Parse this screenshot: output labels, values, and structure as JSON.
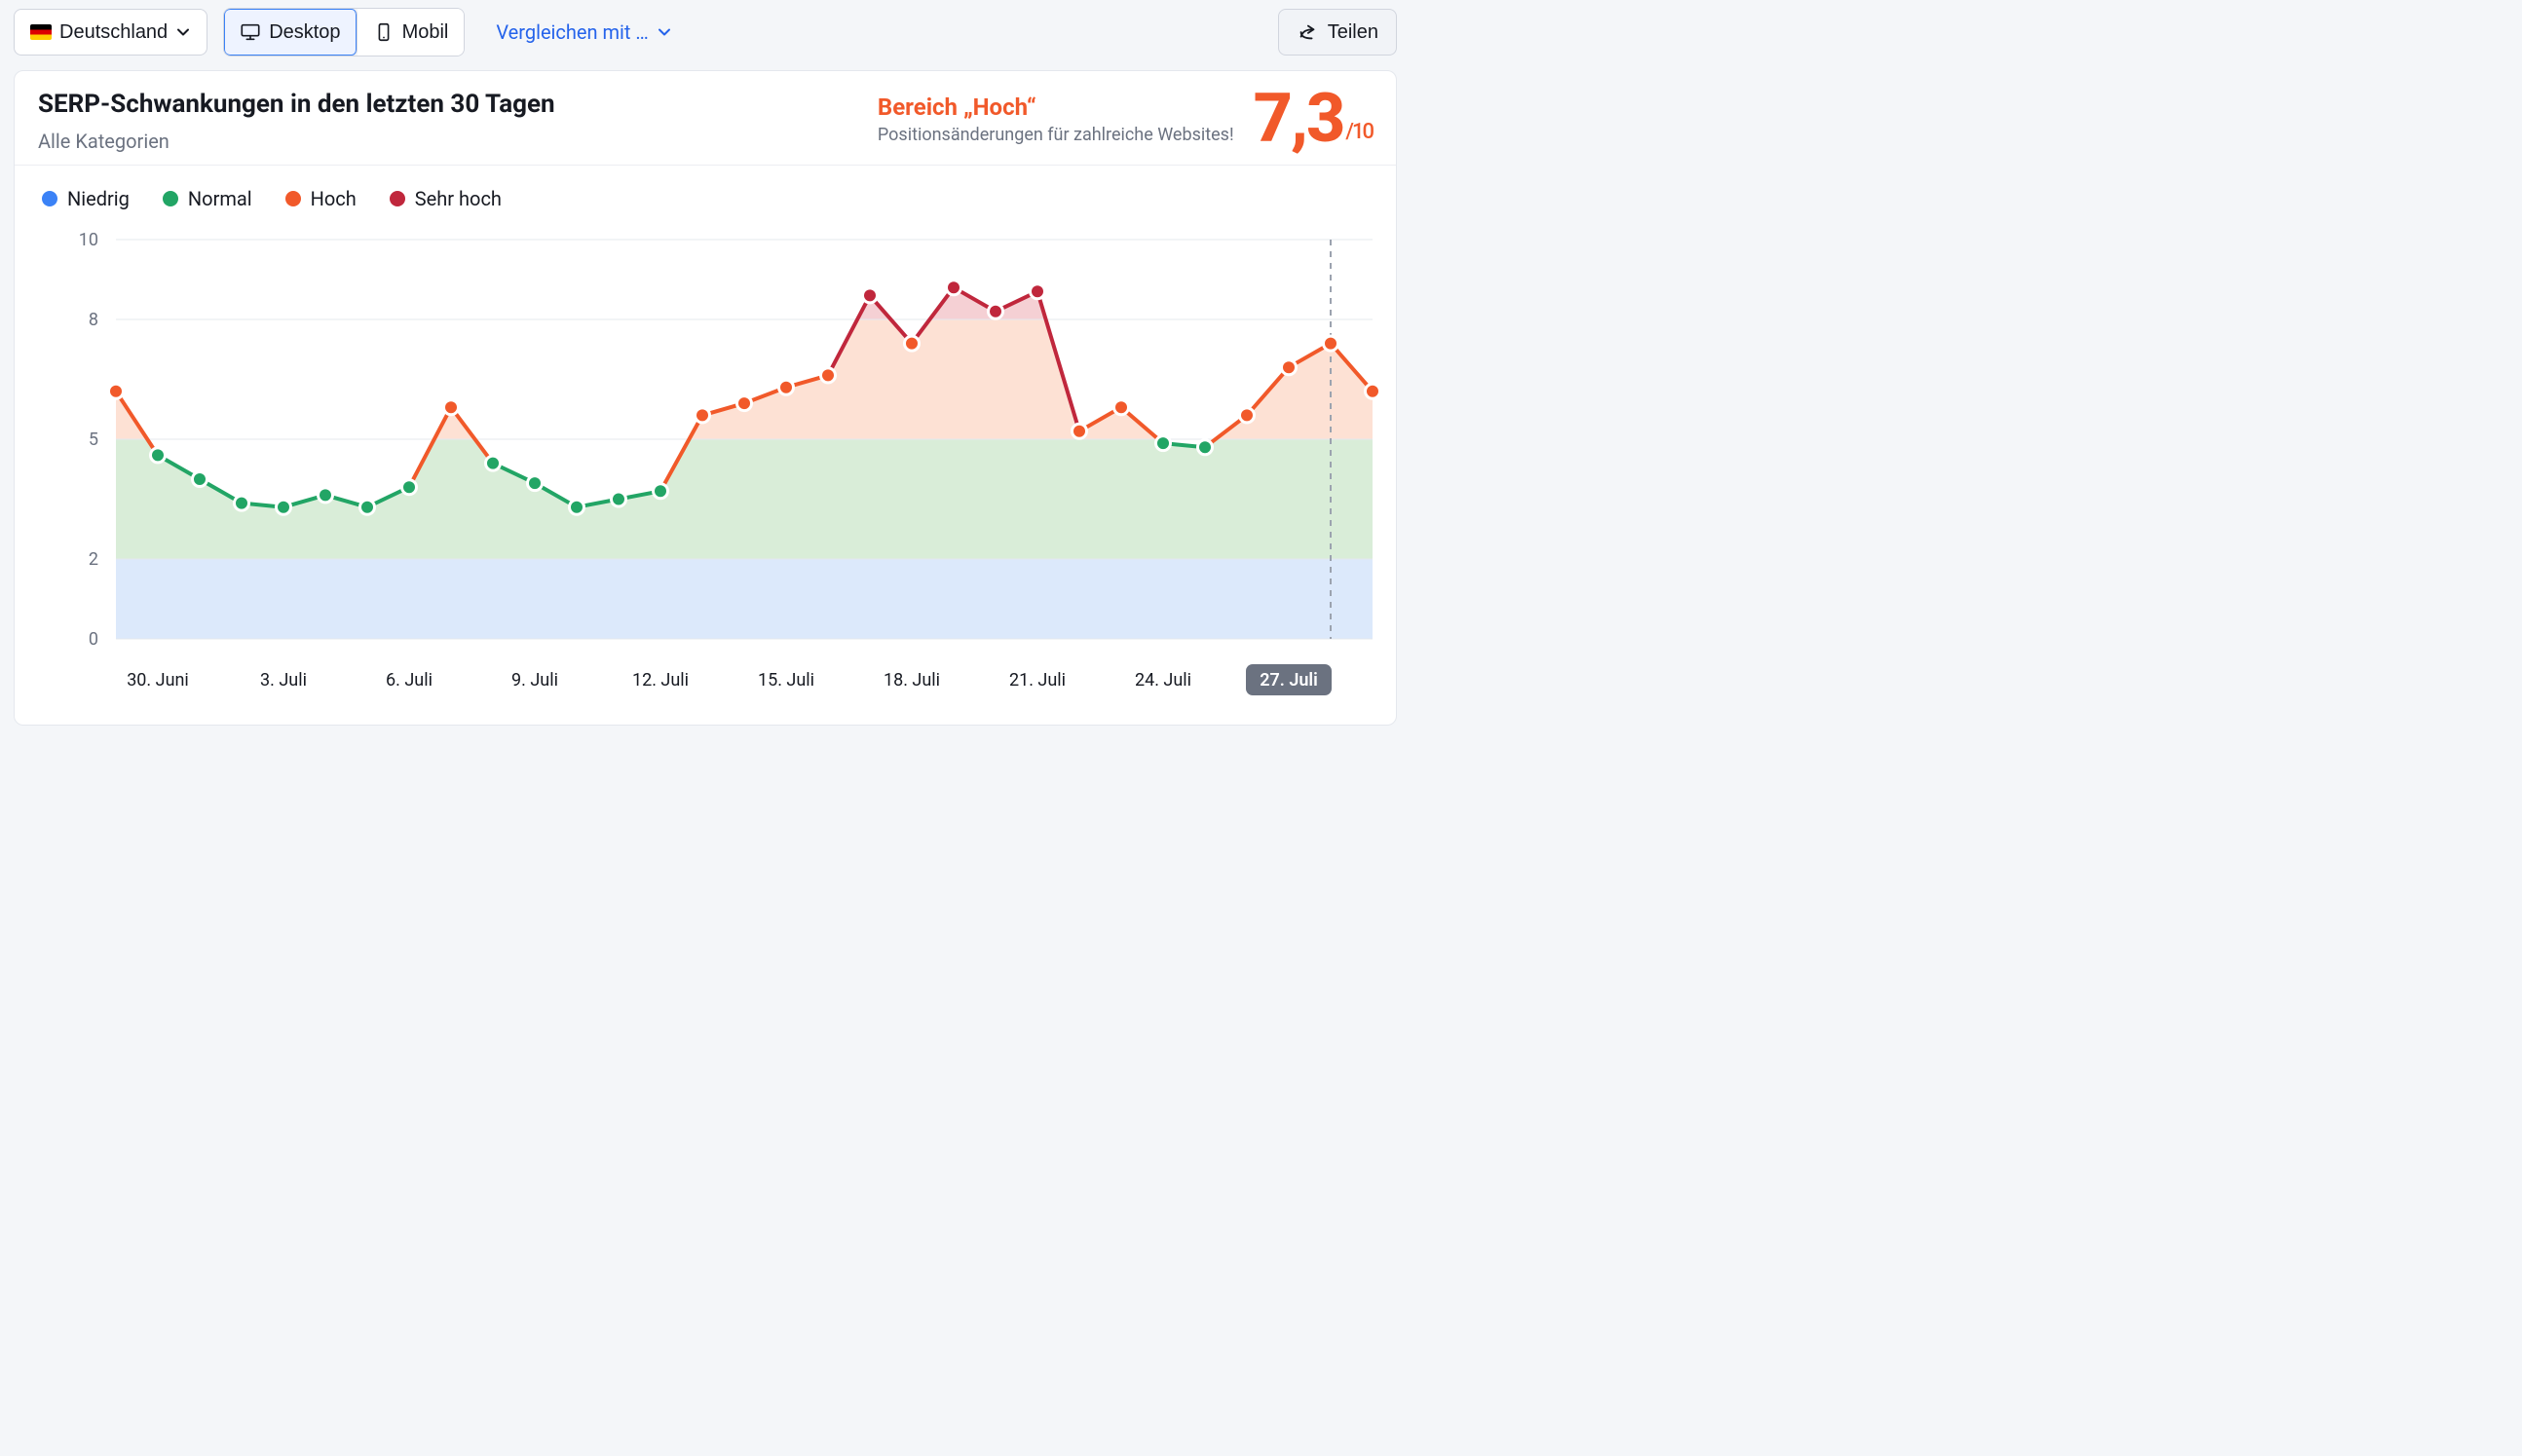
{
  "toolbar": {
    "country_label": "Deutschland",
    "device_desktop": "Desktop",
    "device_mobile": "Mobil",
    "compare_label": "Vergleichen mit …",
    "share_label": "Teilen"
  },
  "panel": {
    "title": "SERP-Schwankungen in den letzten 30 Tagen",
    "subtitle": "Alle Kategorien",
    "range_label": "Bereich „Hoch“",
    "range_desc": "Positionsänderungen für zahlreiche Websites!",
    "score": "7,3",
    "score_max": "/10"
  },
  "legend": {
    "low": {
      "label": "Niedrig",
      "color": "#3b82f6"
    },
    "normal": {
      "label": "Normal",
      "color": "#22a565"
    },
    "high": {
      "label": "Hoch",
      "color": "#f1592a"
    },
    "veryhigh": {
      "label": "Sehr hoch",
      "color": "#c0273c"
    }
  },
  "chart_data": {
    "type": "line",
    "ylabel": "",
    "xlabel": "",
    "ylim": [
      0,
      10
    ],
    "yticks": [
      0,
      2,
      5,
      8,
      10
    ],
    "bands": {
      "low": [
        0,
        2
      ],
      "normal": [
        2,
        5
      ],
      "high": [
        5,
        8
      ],
      "veryhigh": [
        8,
        10
      ]
    },
    "xticks": [
      "30. Juni",
      "3. Juli",
      "6. Juli",
      "9. Juli",
      "12. Juli",
      "15. Juli",
      "18. Juli",
      "21. Juli",
      "24. Juli",
      "27. Juli"
    ],
    "xtick_active": "27. Juli",
    "x": [
      "29. Juni",
      "30. Juni",
      "1. Juli",
      "2. Juli",
      "3. Juli",
      "4. Juli",
      "5. Juli",
      "6. Juli",
      "7. Juli",
      "8. Juli",
      "9. Juli",
      "10. Juli",
      "11. Juli",
      "12. Juli",
      "13. Juli",
      "14. Juli",
      "15. Juli",
      "16. Juli",
      "17. Juli",
      "18. Juli",
      "19. Juli",
      "20. Juli",
      "21. Juli",
      "22. Juli",
      "23. Juli",
      "24. Juli",
      "25. Juli",
      "26. Juli",
      "27. Juli",
      "28. Juli"
    ],
    "values": [
      6.2,
      4.6,
      4.0,
      3.4,
      3.3,
      3.6,
      3.3,
      3.8,
      5.8,
      4.4,
      3.9,
      3.3,
      3.5,
      3.7,
      5.6,
      5.9,
      6.3,
      6.6,
      8.6,
      7.4,
      8.8,
      8.2,
      8.7,
      5.2,
      5.8,
      4.9,
      4.8,
      5.6,
      6.8,
      7.4,
      6.2
    ],
    "today_index": 29,
    "colors": {
      "low": "#3b82f6",
      "normal": "#22a565",
      "high": "#f1592a",
      "veryhigh": "#c0273c"
    }
  }
}
